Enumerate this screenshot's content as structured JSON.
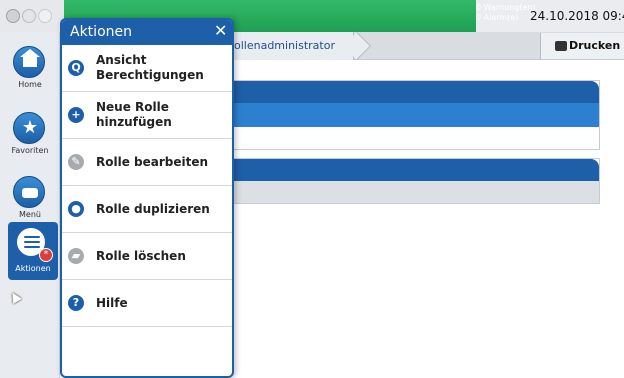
{
  "status": {
    "warnings": "0 Warnung(en)",
    "alarms": "0 Alarm(e)",
    "datetime": "24.10.2018 09:4"
  },
  "breadcrumb": {
    "current": "ollenadministrator"
  },
  "toolbar": {
    "print_label": "Drucken (",
    "print_icon": "printer-icon"
  },
  "rail": {
    "items": [
      {
        "label": "Home",
        "icon": "home-icon"
      },
      {
        "label": "Favoriten",
        "icon": "star-icon"
      },
      {
        "label": "Menü",
        "icon": "menu-icon"
      },
      {
        "label": "Aktionen",
        "icon": "actions-icon"
      }
    ]
  },
  "menu": {
    "title": "Aktionen",
    "close_glyph": "✕",
    "items": [
      {
        "line1": "Ansicht",
        "line2": "Berechtigungen",
        "icon": "search-icon",
        "glyph": "Q",
        "enabled": true
      },
      {
        "line1": "Neue Rolle",
        "line2": "hinzufügen",
        "icon": "plus-icon",
        "glyph": "+",
        "enabled": true
      },
      {
        "line1": "Rolle bearbeiten",
        "line2": "",
        "icon": "pencil-icon",
        "glyph": "✎",
        "enabled": false
      },
      {
        "line1": "Rolle duplizieren",
        "line2": "",
        "icon": "users-icon",
        "glyph": "●",
        "enabled": true
      },
      {
        "line1": "Rolle löschen",
        "line2": "",
        "icon": "eraser-icon",
        "glyph": "▰",
        "enabled": false
      },
      {
        "line1": "Hilfe",
        "line2": "",
        "icon": "help-icon",
        "glyph": "?",
        "enabled": true
      }
    ]
  },
  "colors": {
    "brand_blue": "#1d5fa8",
    "status_green": "#1f9f53",
    "alert_red": "#e03b3b"
  }
}
